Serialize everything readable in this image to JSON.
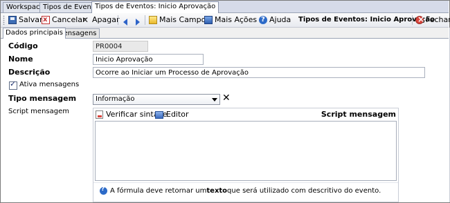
{
  "doc_tabs": [
    "Workspace",
    "Tipos de Eventos",
    "Tipos de Eventos: Inicio Aprovação"
  ],
  "toolbar": {
    "save": "Salvar",
    "cancel": "Cancelar",
    "delete": "Apagar",
    "more_fields": "Mais Campos",
    "more_actions": "Mais Ações",
    "help": "Ajuda",
    "record_title": "Tipos de Eventos: Inicio Aprovação",
    "close": "Fechar"
  },
  "form_tabs": [
    "Dados principais",
    "Mensagens"
  ],
  "form": {
    "codigo_label": "Código",
    "codigo_value": "PR0004",
    "nome_label": "Nome",
    "nome_value": "Inicio Aprovação",
    "descricao_label": "Descrição",
    "descricao_value": "Ocorre ao Iniciar um Processo de Aprovação",
    "ativa_label": "Ativa mensagens",
    "ativa_checked": true,
    "tipo_label": "Tipo mensagem",
    "tipo_value": "Informação",
    "script_label": "Script mensagem"
  },
  "editor": {
    "verify": "Verificar sintaxe",
    "editor": "Editor",
    "title": "Script mensagem",
    "hint_pre": "A fórmula deve retornar um ",
    "hint_bold": "texto",
    "hint_post": " que será utilizado com descritivo do evento."
  }
}
